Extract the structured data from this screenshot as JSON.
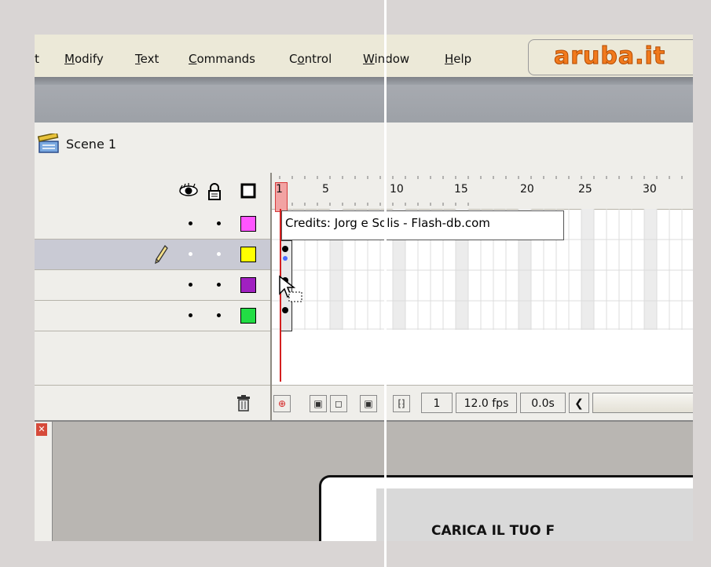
{
  "menu": {
    "items": [
      "rt",
      "Modify",
      "Text",
      "Commands",
      "Control",
      "Window",
      "Help"
    ]
  },
  "logo": "aruba.it",
  "scene": {
    "label": "Scene 1"
  },
  "timeline": {
    "ruler_labels": [
      "1",
      "5",
      "10",
      "15",
      "20",
      "25",
      "30"
    ],
    "credits_text": "Credits: Jorg e Solis - Flash-db.com",
    "layers": [
      {
        "color": "#ff55ff",
        "selected": false
      },
      {
        "color": "#ffff00",
        "selected": true
      },
      {
        "color": "#a020c0",
        "selected": false
      },
      {
        "color": "#22dd44",
        "selected": false
      }
    ],
    "current_frame": "1",
    "fps": "12.0 fps",
    "elapsed": "0.0s"
  },
  "stage": {
    "title": "CARICA IL TUO F"
  },
  "colors": {
    "accent": "#f17a1d",
    "playhead": "#d41f1f"
  }
}
